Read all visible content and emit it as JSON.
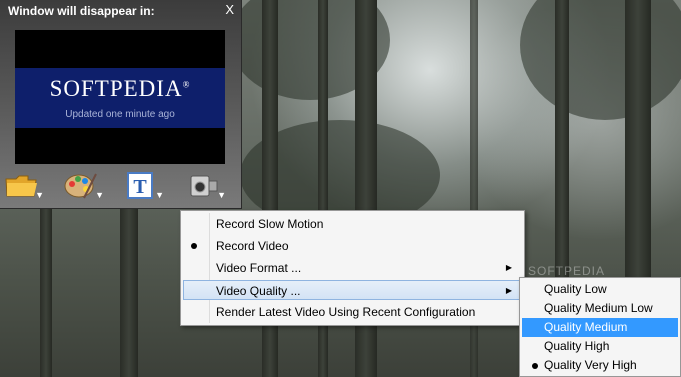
{
  "widget": {
    "title": "Window will disappear in:",
    "close_label": "X",
    "logo_text": "SOFTPEDIA",
    "logo_mark": "®",
    "logo_subtitle": "Updated one minute ago",
    "toolbar": [
      {
        "icon": "folder-icon",
        "arrow": "▼"
      },
      {
        "icon": "palette-icon",
        "arrow": "▼"
      },
      {
        "icon": "text-icon",
        "letter": "T",
        "arrow": "▼"
      },
      {
        "icon": "camcorder-icon",
        "arrow": "▼"
      }
    ]
  },
  "menu": {
    "items": [
      {
        "label": "Record Slow Motion",
        "checked": false
      },
      {
        "label": "Record Video",
        "checked": true
      },
      {
        "label": "Video Format ...",
        "submenu": "▶"
      },
      {
        "label": "Video Quality ...",
        "submenu": "▶",
        "highlighted": true
      },
      {
        "label": "Render Latest Video Using Recent Configuration"
      }
    ]
  },
  "submenu": {
    "items": [
      {
        "label": "Quality Low"
      },
      {
        "label": "Quality Medium Low"
      },
      {
        "label": "Quality Medium",
        "selected": true
      },
      {
        "label": "Quality High"
      },
      {
        "label": "Quality Very High",
        "checked": true
      }
    ]
  },
  "colors": {
    "menu_highlight": "#d3e3f5",
    "submenu_selection": "#3399ff",
    "logo_background": "#0e1f6b"
  }
}
